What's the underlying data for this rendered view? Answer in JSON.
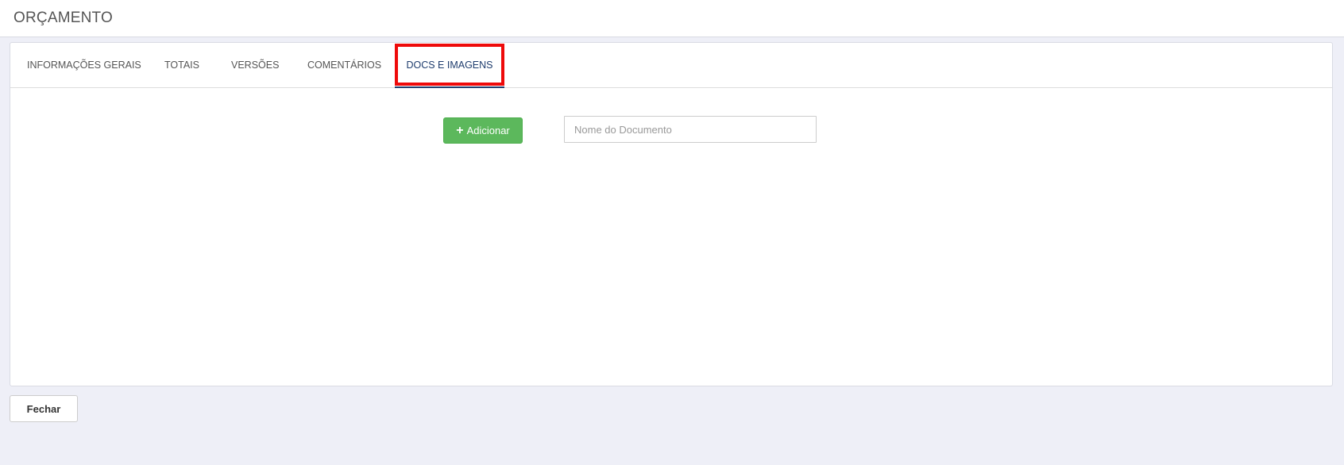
{
  "header": {
    "title": "ORÇAMENTO"
  },
  "tabs": [
    {
      "label": "INFORMAÇÕES GERAIS",
      "active": false
    },
    {
      "label": "TOTAIS",
      "active": false
    },
    {
      "label": "VERSÕES",
      "active": false
    },
    {
      "label": "COMENTÁRIOS",
      "active": false
    },
    {
      "label": "DOCS E IMAGENS",
      "active": true
    }
  ],
  "documents": {
    "add_label": "Adicionar",
    "add_icon": "plus-icon",
    "name_placeholder": "Nome do Documento",
    "name_value": ""
  },
  "footer": {
    "close_label": "Fechar"
  },
  "colors": {
    "add_button": "#5cb85c",
    "active_tab": "#1f3d6e",
    "highlight": "#ee0a0a",
    "background": "#eeeff7"
  }
}
